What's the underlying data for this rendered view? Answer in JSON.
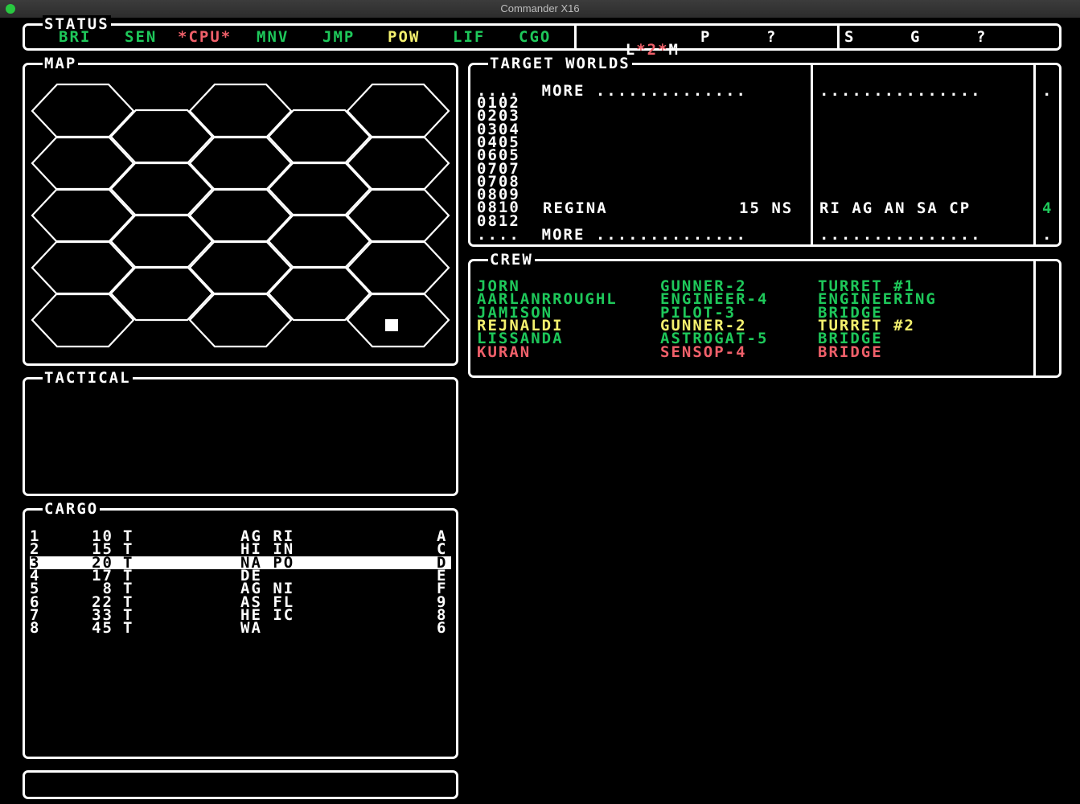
{
  "window": {
    "title": "Commander X16"
  },
  "status": {
    "title": "STATUS",
    "systems": [
      {
        "label": "BRI",
        "color": "green"
      },
      {
        "label": "SEN",
        "color": "green"
      },
      {
        "label": "*CPU*",
        "color": "red"
      },
      {
        "label": "MNV",
        "color": "green"
      },
      {
        "label": "JMP",
        "color": "green"
      },
      {
        "label": "POW",
        "color": "yellow"
      },
      {
        "label": "LIF",
        "color": "green"
      },
      {
        "label": "CGO",
        "color": "green"
      }
    ],
    "mode": {
      "l": "L",
      "mid": "*2*",
      "m": "M",
      "p": "P",
      "q": "?"
    },
    "right": {
      "s": "S",
      "g": "G",
      "q": "?"
    }
  },
  "map": {
    "title": "MAP"
  },
  "target_worlds": {
    "title": "TARGET WORLDS",
    "more_top": "....  MORE ..............",
    "more_top_right": "...............",
    "more_bottom": "....  MORE ..............",
    "more_bottom_right": "...............",
    "dot": ".",
    "codes": [
      "0102",
      "0203",
      "0304",
      "0405",
      "0605",
      "0707",
      "0708",
      "0809",
      "0810",
      "0812"
    ],
    "selected": {
      "name": "REGINA",
      "info": "15 NS",
      "trade": "RI AG AN SA CP",
      "count": "4"
    }
  },
  "crew": {
    "title": "CREW",
    "members": [
      {
        "name": "JORN",
        "skill": "GUNNER-2",
        "station": "TURRET #1",
        "color": "green"
      },
      {
        "name": "AARLANRROUGHL",
        "skill": "ENGINEER-4",
        "station": "ENGINEERING",
        "color": "green"
      },
      {
        "name": "JAMISON",
        "skill": "PILOT-3",
        "station": "BRIDGE",
        "color": "green"
      },
      {
        "name": "REJNALDI",
        "skill": "GUNNER-2",
        "station": "TURRET #2",
        "color": "yellow"
      },
      {
        "name": "LISSANDA",
        "skill": "ASTROGAT-5",
        "station": "BRIDGE",
        "color": "green"
      },
      {
        "name": "KURAN",
        "skill": "SENSOP-4",
        "station": "BRIDGE",
        "color": "red"
      }
    ]
  },
  "tactical": {
    "title": "TACTICAL"
  },
  "cargo": {
    "title": "CARGO",
    "rows": [
      {
        "n": "1",
        "qty": "10",
        "unit": "T",
        "codes": "AG RI",
        "id": "A"
      },
      {
        "n": "2",
        "qty": "15",
        "unit": "T",
        "codes": "HI IN",
        "id": "C"
      },
      {
        "n": "3",
        "qty": "20",
        "unit": "T",
        "codes": "NA PO",
        "id": "D"
      },
      {
        "n": "4",
        "qty": "17",
        "unit": "T",
        "codes": "DE",
        "id": "E"
      },
      {
        "n": "5",
        "qty": "8",
        "unit": "T",
        "codes": "AG NI",
        "id": "F"
      },
      {
        "n": "6",
        "qty": "22",
        "unit": "T",
        "codes": "AS FL",
        "id": "9"
      },
      {
        "n": "7",
        "qty": "33",
        "unit": "T",
        "codes": "HE IC",
        "id": "8"
      },
      {
        "n": "8",
        "qty": "45",
        "unit": "T",
        "codes": "WA",
        "id": "6"
      }
    ],
    "selected_index": 2
  },
  "command": {
    "value": ""
  },
  "colors": {
    "green": "#1ec85a",
    "yellow": "#f3f06e",
    "red": "#f0606a",
    "white": "#ffffff",
    "background": "#000000"
  }
}
